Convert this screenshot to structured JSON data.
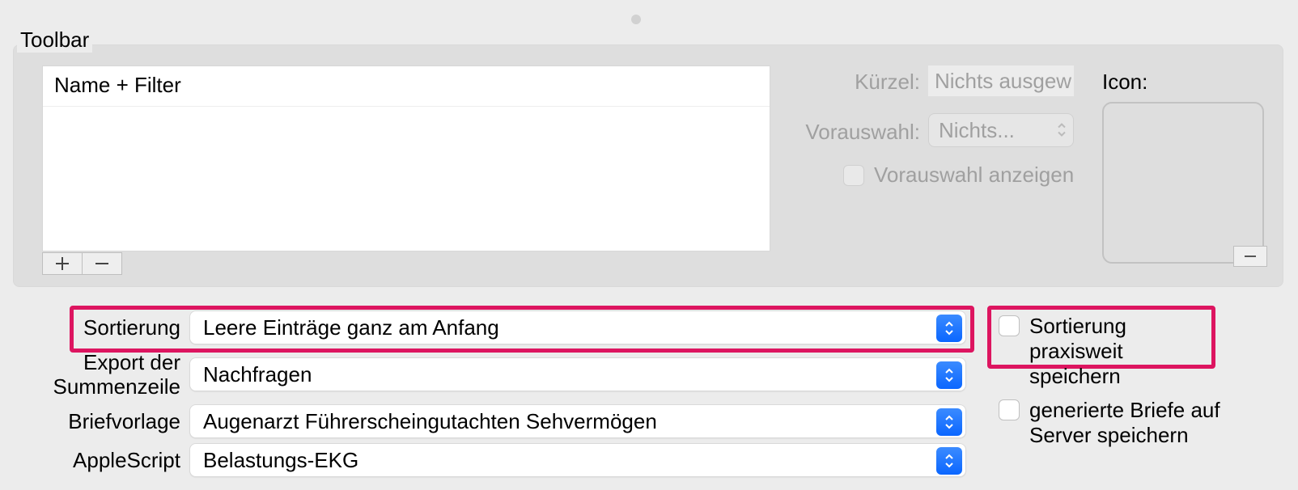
{
  "toolbar": {
    "legend": "Toolbar",
    "list_header": "Name + Filter",
    "kurzel_label": "Kürzel:",
    "kurzel_placeholder": "Nichts ausgew",
    "vorauswahl_label": "Vorauswahl:",
    "vorauswahl_value": "Nichts...",
    "vorauswahl_anzeigen": "Vorauswahl anzeigen",
    "icon_label": "Icon:"
  },
  "form": {
    "sortierung_label": "Sortierung",
    "sortierung_value": "Leere Einträge ganz am Anfang",
    "export_label_l1": "Export der",
    "export_label_l2": "Summenzeile",
    "export_value": "Nachfragen",
    "brief_label": "Briefvorlage",
    "brief_value": "Augenarzt Führerscheingutachten Sehvermögen",
    "apple_label": "AppleScript",
    "apple_value": "Belastungs-EKG",
    "sort_praxis_l1": "Sortierung praxisweit",
    "sort_praxis_l2": "speichern",
    "gen_briefe_l1": "generierte Briefe auf",
    "gen_briefe_l2": "Server speichern"
  }
}
